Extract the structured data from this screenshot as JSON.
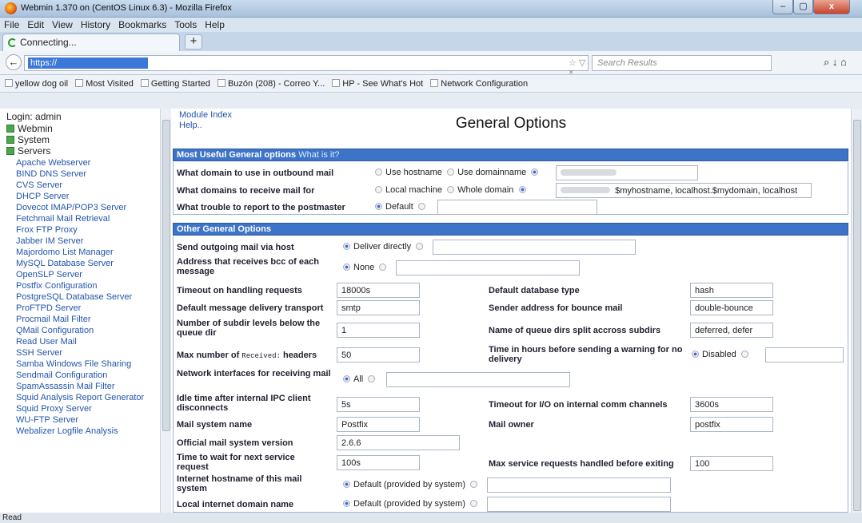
{
  "window": {
    "title": "Webmin 1.370 on                   (CentOS Linux 6.3) - Mozilla Firefox",
    "min": "–",
    "max": "▢",
    "close": "x"
  },
  "menu": [
    "File",
    "Edit",
    "View",
    "History",
    "Bookmarks",
    "Tools",
    "Help"
  ],
  "tab": {
    "label": "Connecting...",
    "new": "+"
  },
  "nav": {
    "url": "https://",
    "url_ctl": "☆ ▽ ×",
    "search_placeholder": "Search Results",
    "icons": "⌕  ↓  ⌂",
    "back": "←"
  },
  "bookmarks": [
    "yellow dog oil",
    "Most Visited",
    "Getting Started",
    "Buzón (208) - Correo Y...",
    "HP - See What's Hot",
    "Network Configuration"
  ],
  "sidebar": {
    "login": "Login: admin",
    "categories": [
      "Webmin",
      "System",
      "Servers"
    ],
    "modules": [
      "Apache Webserver",
      "BIND DNS Server",
      "CVS Server",
      "DHCP Server",
      "Dovecot IMAP/POP3 Server",
      "Fetchmail Mail Retrieval",
      "Frox FTP Proxy",
      "Jabber IM Server",
      "Majordomo List Manager",
      "MySQL Database Server",
      "OpenSLP Server",
      "Postfix Configuration",
      "PostgreSQL Database Server",
      "ProFTPD Server",
      "Procmail Mail Filter",
      "QMail Configuration",
      "Read User Mail",
      "SSH Server",
      "Samba Windows File Sharing",
      "Sendmail Configuration",
      "SpamAssassin Mail Filter",
      "Squid Analysis Report Generator",
      "Squid Proxy Server",
      "WU-FTP Server",
      "Webalizer Logfile Analysis"
    ]
  },
  "page": {
    "module_index": "Module Index",
    "help": "Help..",
    "title": "General Options"
  },
  "sec1": {
    "title": "Most Useful General options",
    "whatis": "What is it?",
    "r1": {
      "label": "What domain to use in outbound mail",
      "o1": "Use hostname",
      "o2": "Use domainname"
    },
    "r2": {
      "label": "What domains to receive mail for",
      "o1": "Local machine",
      "o2": "Whole domain",
      "value": "$myhostname, localhost.$mydomain, localhost"
    },
    "r3": {
      "label": "What trouble to report to the postmaster",
      "o1": "Default"
    }
  },
  "sec2": {
    "title": "Other General Options",
    "relay": {
      "label": "Send outgoing mail via host",
      "o1": "Deliver directly"
    },
    "bcc": {
      "label": "Address that receives bcc of each message",
      "o1": "None"
    },
    "timeout": {
      "label": "Timeout on handling requests",
      "value": "18000s"
    },
    "dbtype": {
      "label": "Default database type",
      "value": "hash"
    },
    "transport": {
      "label": "Default message delivery transport",
      "value": "smtp"
    },
    "bounce": {
      "label": "Sender address for bounce mail",
      "value": "double-bounce"
    },
    "subdir": {
      "label": "Number of subdir levels below the queue dir",
      "value": "1"
    },
    "queuedirs": {
      "label": "Name of queue dirs split accross subdirs",
      "value": "deferred, defer"
    },
    "received": {
      "label_a": "Max number of",
      "label_code": "Received:",
      "label_b": "headers",
      "value": "50"
    },
    "warning": {
      "label": "Time in hours before sending a warning for no delivery",
      "o1": "Disabled"
    },
    "netif": {
      "label": "Network interfaces for receiving mail",
      "o1": "All"
    },
    "idle": {
      "label": "Idle time after internal IPC client disconnects",
      "value": "5s"
    },
    "ipc": {
      "label": "Timeout for I/O on internal comm channels",
      "value": "3600s"
    },
    "mailname": {
      "label": "Mail system name",
      "value": "Postfix"
    },
    "owner": {
      "label": "Mail owner",
      "value": "postfix"
    },
    "version": {
      "label": "Official mail system version",
      "value": "2.6.6"
    },
    "wait": {
      "label": "Time to wait for next service request",
      "value": "100s"
    },
    "maxreq": {
      "label": "Max service requests handled before exiting",
      "value": "100"
    },
    "hostname": {
      "label": "Internet hostname of this mail system",
      "o1": "Default (provided by system)"
    },
    "domain": {
      "label": "Local internet domain name",
      "o1": "Default (provided by system)"
    }
  },
  "status": "Read"
}
